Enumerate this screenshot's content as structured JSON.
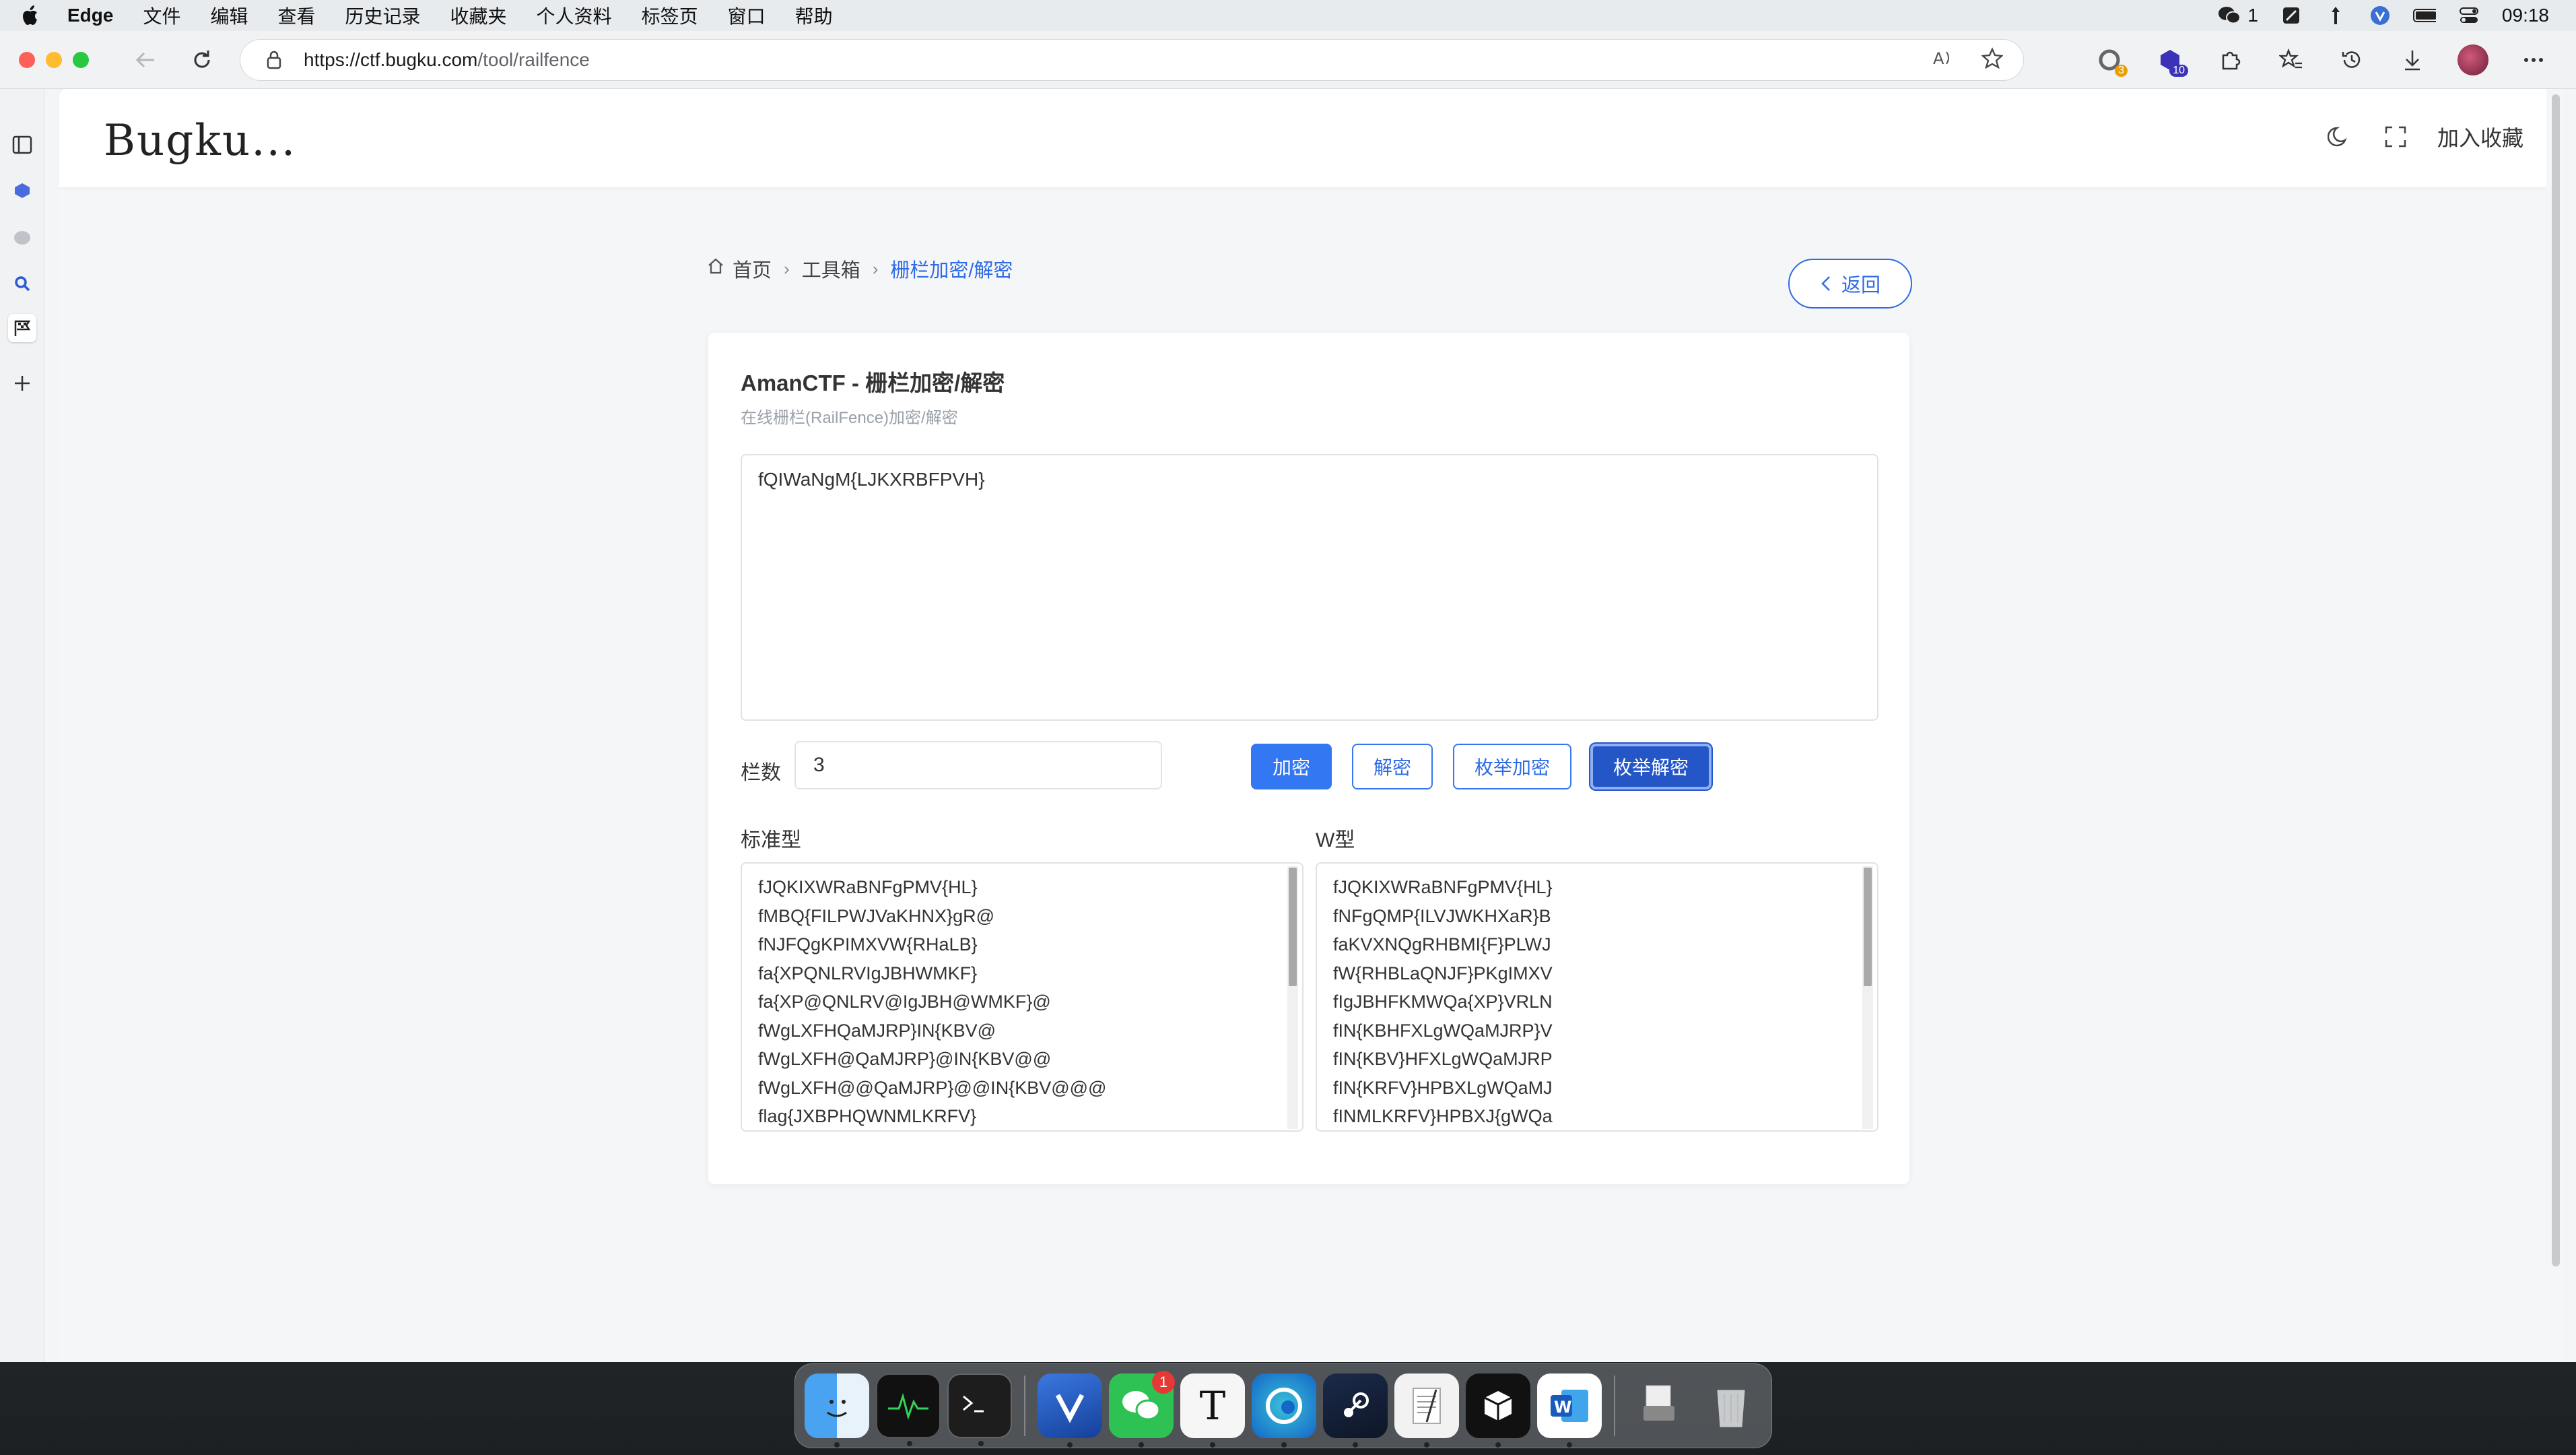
{
  "menubar": {
    "app": "Edge",
    "items": [
      "文件",
      "编辑",
      "查看",
      "历史记录",
      "收藏夹",
      "个人资料",
      "标签页",
      "窗口",
      "帮助"
    ],
    "wechat_count": "1",
    "time": "09:18"
  },
  "browser": {
    "url_host": "https://ctf.bugku.com",
    "url_path": "/tool/railfence",
    "ext_badge_1": "3",
    "ext_badge_2": "10"
  },
  "site": {
    "logo": "Bugku...",
    "bookmark_label": "加入收藏"
  },
  "breadcrumb": {
    "home": "首页",
    "tools": "工具箱",
    "current": "栅栏加密/解密"
  },
  "back_label": "返回",
  "card": {
    "title": "AmanCTF - 栅栏加密/解密",
    "subtitle": "在线栅栏(RailFence)加密/解密",
    "input_text": "fQIWaNgM{LJKXRBFPVH}",
    "rails_label": "栏数",
    "rails_value": "3",
    "buttons": {
      "encrypt": "加密",
      "decrypt": "解密",
      "enum_encrypt": "枚举加密",
      "enum_decrypt": "枚举解密"
    },
    "standard_label": "标准型",
    "w_label": "W型",
    "standard_results": [
      "fJQKIXWRaBNFgPMV{HL}",
      "fMBQ{FILPWJVaKHNX}gR@",
      "fNJFQgKPIMXVW{RHaLB}",
      "fa{XPQNLRVIgJBHWMKF}",
      "fa{XP@QNLRV@IgJBH@WMKF}@",
      "fWgLXFHQaMJRP}IN{KBV@",
      "fWgLXFH@QaMJRP}@IN{KBV@@",
      "fWgLXFH@@QaMJRP}@@IN{KBV@@@",
      "flag{JXBPHQWNMLKRFV}"
    ],
    "w_results": [
      "fJQKIXWRaBNFgPMV{HL}",
      "fNFgQMP{ILVJWKHXaR}B",
      "faKVXNQgRHBMI{F}PLWJ",
      "fW{RHBLaQNJF}PKgIMXV",
      "fIgJBHFKMWQa{XP}VRLN",
      "fIN{KBHFXLgWQaMJRP}V",
      "fIN{KBV}HFXLgWQaMJRP",
      "fIN{KRFV}HPBXLgWQaMJ",
      "fINMLKRFV}HPBXJ{gWQa"
    ]
  }
}
